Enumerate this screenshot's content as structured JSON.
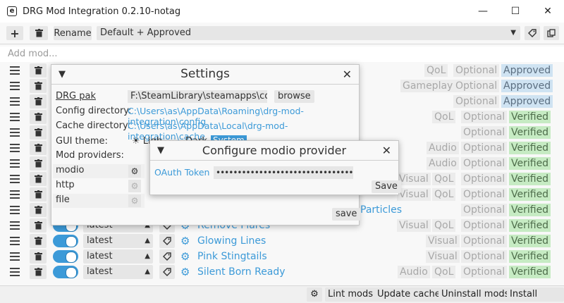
{
  "window": {
    "title": "DRG Mod Integration 0.2.10-notag",
    "app_icon": "e",
    "minimize": "—",
    "maximize": "☐",
    "close": "✕"
  },
  "toolbar": {
    "add": "+",
    "delete_icon": "trash-icon",
    "rename": "Rename",
    "profile": "Default + Approved",
    "dropdown_arrow": "▼"
  },
  "add_mod_placeholder": "Add mod...",
  "colors": {
    "accent": "#3c9ad8",
    "approved_bg": "#cfe3f2",
    "verified_bg": "#c6ebc3"
  },
  "mods": [
    {
      "version": "",
      "name": "",
      "tags": [
        "QoL",
        "Optional",
        "Approved"
      ]
    },
    {
      "version": "",
      "name": "",
      "tags": [
        "Gameplay",
        "Optional",
        "Approved"
      ]
    },
    {
      "version": "",
      "name": "",
      "tags": [
        "Optional",
        "Approved"
      ]
    },
    {
      "version": "",
      "name": "",
      "tags": [
        "QoL",
        "Optional",
        "Verified"
      ]
    },
    {
      "version": "",
      "name": "",
      "tags": [
        "Optional",
        "Verified"
      ]
    },
    {
      "version": "",
      "name": "",
      "tags": [
        "Audio",
        "Optional",
        "Verified"
      ]
    },
    {
      "version": "",
      "name": "",
      "tags": [
        "Audio",
        "Optional",
        "Verified"
      ]
    },
    {
      "version": "",
      "name": "",
      "tags": [
        "Visual",
        "QoL",
        "Optional",
        "Verified"
      ]
    },
    {
      "version": "",
      "name": "",
      "tags": [
        "Visual",
        "QoL",
        "Optional",
        "Verified"
      ]
    },
    {
      "version": "",
      "name": "Particles",
      "tags": [
        "Optional",
        "Verified"
      ]
    },
    {
      "version": "latest",
      "name": "Remove Flares",
      "tags": [
        "Visual",
        "QoL",
        "Optional",
        "Verified"
      ]
    },
    {
      "version": "latest",
      "name": "Glowing Lines",
      "tags": [
        "Visual",
        "Optional",
        "Verified"
      ]
    },
    {
      "version": "latest",
      "name": "Pink Stingtails",
      "tags": [
        "Visual",
        "Optional",
        "Verified"
      ]
    },
    {
      "version": "latest",
      "name": "Silent Born Ready",
      "tags": [
        "Audio",
        "QoL",
        "Optional",
        "Verified"
      ]
    }
  ],
  "bottom": {
    "gear_icon": "gear-icon",
    "lint": "Lint mods",
    "update_cache": "Update cache",
    "uninstall": "Uninstall mods",
    "install": "Install mods"
  },
  "settings": {
    "title": "Settings",
    "drg_pak_label": "DRG pak",
    "drg_pak_value": "F:\\SteamLibrary\\steamapps\\commo",
    "browse": "browse",
    "config_dir_label": "Config directory:",
    "config_dir_value": "C:\\Users\\as\\AppData\\Roaming\\drg-mod-integration\\config",
    "cache_dir_label": "Cache directory:",
    "cache_dir_value": "C:\\Users\\as\\AppData\\Local\\drg-mod-integration\\cache",
    "theme_label": "GUI theme:",
    "theme_light": "Ligh",
    "theme_dark": "Dark",
    "theme_system": "System",
    "providers_label": "Mod providers:",
    "providers": [
      "modio",
      "http",
      "file"
    ],
    "save": "save"
  },
  "modio": {
    "title": "Configure modio provider",
    "oauth_label": "OAuth Token",
    "token": "••••••••••••••••••••••••••••••••••••••••••••••",
    "save": "Save"
  }
}
